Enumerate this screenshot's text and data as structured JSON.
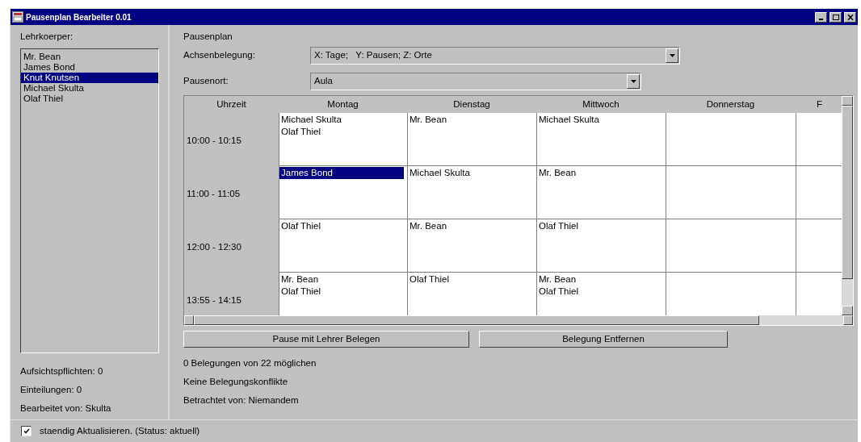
{
  "window": {
    "title": "Pausenplan Bearbeiter 0.01"
  },
  "teachers": {
    "label": "Lehrkoerper:",
    "items": [
      {
        "name": "Mr. Bean",
        "selected": false
      },
      {
        "name": "James Bond",
        "selected": false
      },
      {
        "name": "Knut Knutsen",
        "selected": true
      },
      {
        "name": "Michael Skulta",
        "selected": false
      },
      {
        "name": "Olaf Thiel",
        "selected": false
      }
    ]
  },
  "teacher_info": [
    "Aufsichtspflichten: 0",
    "Einteilungen: 0",
    "Bearbeitet von: Skulta"
  ],
  "plan": {
    "title": "Pausenplan",
    "axis": {
      "label": "Achsenbelegung:",
      "value": "X: Tage;   Y: Pausen; Z: Orte"
    },
    "place": {
      "label": "Pausenort:",
      "value": "Aula"
    },
    "columns": [
      "Uhrzeit",
      "Montag",
      "Dienstag",
      "Mittwoch",
      "Donnerstag",
      "F"
    ],
    "rows": [
      {
        "time": "10:00 - 10:15",
        "cells": [
          [
            {
              "name": "Michael Skulta",
              "selected": false
            },
            {
              "name": "Olaf Thiel",
              "selected": false
            }
          ],
          [
            {
              "name": "Mr. Bean",
              "selected": false
            }
          ],
          [
            {
              "name": "Michael Skulta",
              "selected": false
            }
          ]
        ]
      },
      {
        "time": "11:00 - 11:05",
        "cells": [
          [
            {
              "name": "James Bond",
              "selected": true
            }
          ],
          [
            {
              "name": "Michael Skulta",
              "selected": false
            }
          ],
          [
            {
              "name": "Mr. Bean",
              "selected": false
            }
          ]
        ]
      },
      {
        "time": "12:00 - 12:30",
        "cells": [
          [
            {
              "name": "Olaf Thiel",
              "selected": false
            }
          ],
          [
            {
              "name": "Mr. Bean",
              "selected": false
            }
          ],
          [
            {
              "name": "Olaf Thiel",
              "selected": false
            }
          ]
        ]
      },
      {
        "time": "13:55 - 14:15",
        "cells": [
          [
            {
              "name": "Mr. Bean",
              "selected": false
            },
            {
              "name": "Olaf Thiel",
              "selected": false
            }
          ],
          [
            {
              "name": "Olaf Thiel",
              "selected": false
            }
          ],
          [
            {
              "name": "Mr. Bean",
              "selected": false
            },
            {
              "name": "Olaf Thiel",
              "selected": false
            }
          ]
        ]
      }
    ]
  },
  "buttons": [
    "Pause mit Lehrer Belegen",
    "Belegung Entfernen"
  ],
  "plan_status": [
    "0 Belegungen von 22 möglichen",
    "Keine Belegungskonflikte",
    "Betrachtet von: Niemandem"
  ],
  "auto_refresh": {
    "label": "staendig Aktualisieren. (Status: aktuell)",
    "checked": true
  }
}
